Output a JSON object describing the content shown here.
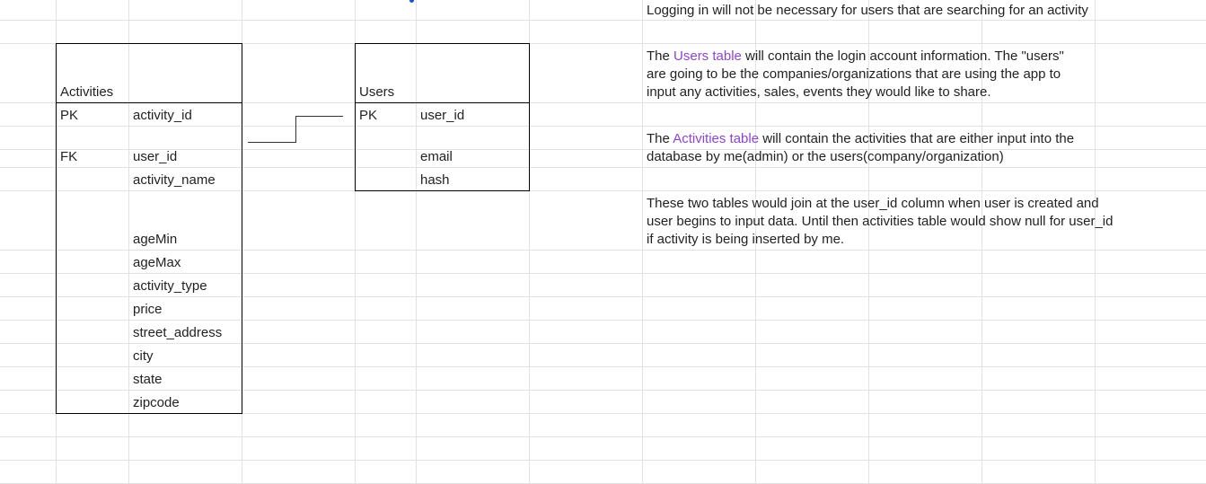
{
  "activities_table": {
    "title": "Activities",
    "rows": [
      {
        "key": "PK",
        "field": "activity_id"
      },
      {
        "key": "",
        "field": ""
      },
      {
        "key": "FK",
        "field": "user_id"
      },
      {
        "key": "",
        "field": "activity_name"
      },
      {
        "key": "",
        "field": ""
      },
      {
        "key": "",
        "field": "ageMin"
      },
      {
        "key": "",
        "field": "ageMax"
      },
      {
        "key": "",
        "field": "activity_type"
      },
      {
        "key": "",
        "field": "price"
      },
      {
        "key": "",
        "field": "street_address"
      },
      {
        "key": "",
        "field": "city"
      },
      {
        "key": "",
        "field": "state"
      },
      {
        "key": "",
        "field": "zipcode"
      }
    ]
  },
  "users_table": {
    "title": "Users",
    "rows": [
      {
        "key": "PK",
        "field": "user_id"
      },
      {
        "key": "",
        "field": "email"
      },
      {
        "key": "",
        "field": "hash"
      }
    ]
  },
  "notes": {
    "login": "Logging in will not be necessary for users that are searching for an activity",
    "users_pre": "The ",
    "users_link": "Users table",
    "users_l1_post": " will contain the login account information. The \"users\"",
    "users_l2": "are going to be the companies/organizations that are using the app to",
    "users_l3": "input any activities, sales, events they would like to share.",
    "activities_pre": "The ",
    "activities_link": "Activities table",
    "activities_l1_post": " will contain the activities that are either input into the",
    "activities_l2": "database by me(admin) or the users(company/organization)",
    "join_l1": "These two tables would join at the user_id column when user is created and",
    "join_l2": "user begins to input data. Until then activities table would show null for user_id",
    "join_l3": "if activity is being inserted by me."
  },
  "colors": {
    "link": "#8e44d6",
    "gridline": "#e2e2e2",
    "border": "#000000"
  }
}
